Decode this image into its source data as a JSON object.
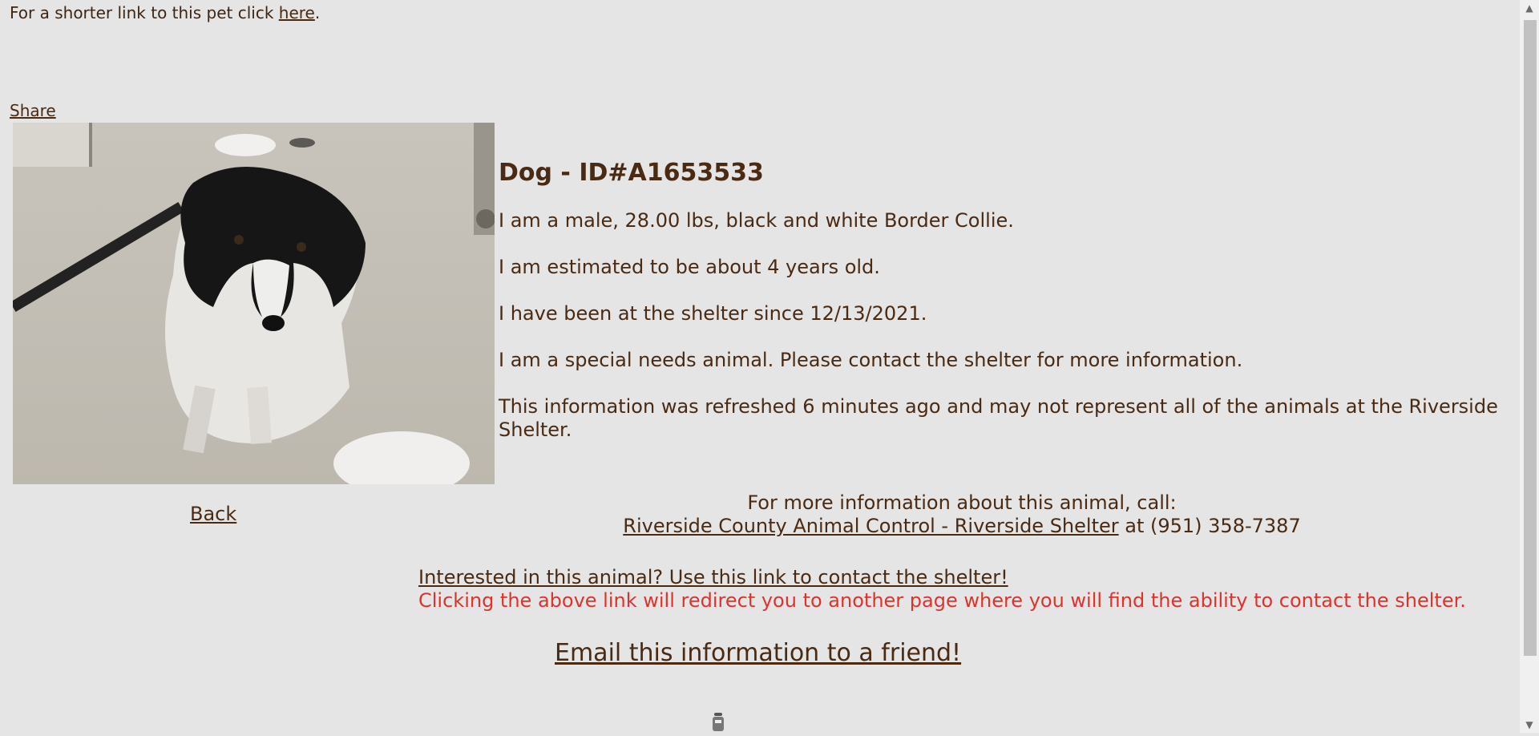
{
  "top_notice": {
    "prefix": "For a shorter link to this pet click ",
    "link_label": "here",
    "suffix": "."
  },
  "share_label": "Share",
  "pet": {
    "heading": "Dog - ID#A1653533",
    "description": "I am a male, 28.00 lbs, black and white Border Collie.",
    "age": "I am estimated to be about 4 years old.",
    "since": "I have been at the shelter since 12/13/2021.",
    "special_needs": "I am a special needs animal. Please contact the shelter for more information.",
    "refresh_note": "This information was refreshed 6 minutes ago and may not represent all of the animals at the Riverside Shelter."
  },
  "back_label": "Back",
  "call": {
    "intro": "For more information about this animal, call:",
    "shelter_link": "Riverside County Animal Control - Riverside Shelter",
    "phone_text": " at (951) 358-7387"
  },
  "contact": {
    "link_label": "Interested in this animal? Use this link to contact the shelter!",
    "redirect_note": "Clicking the above link will redirect you to another page where you will find the ability to contact the shelter."
  },
  "email_label": "Email this information to a friend!",
  "colors": {
    "background": "#e5e5e5",
    "text": "#4a2a12",
    "warning": "#e0322b"
  }
}
